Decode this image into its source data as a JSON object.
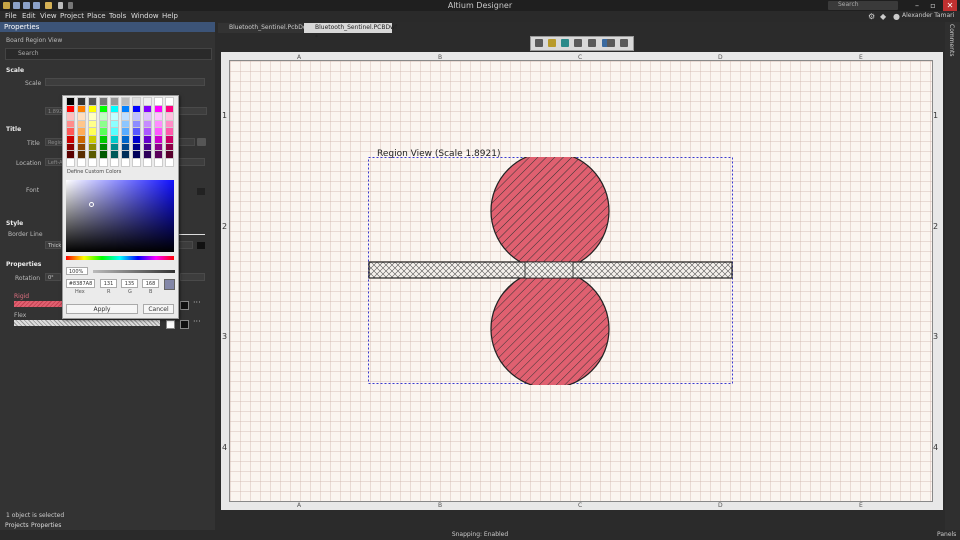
{
  "app": {
    "title": "Altium Designer",
    "search_placeholder": "Search",
    "user": "Alexander Tamari"
  },
  "menu": [
    "File",
    "Edit",
    "View",
    "Project",
    "Place",
    "Tools",
    "Window",
    "Help"
  ],
  "tabs": [
    {
      "label": "Bluetooth_Sentinel.PcbDoc",
      "active": false
    },
    {
      "label": "Bluetooth_Sentinel.PCBDwf *",
      "active": true
    }
  ],
  "panel": {
    "title": "Properties",
    "subtitle": "Board Region View",
    "search_placeholder": "Search",
    "sections": {
      "scale": "Scale",
      "title": "Title",
      "style": "Style",
      "properties": "Properties"
    },
    "labels": {
      "scale": "Scale",
      "title": "Title",
      "location": "Location",
      "font": "Font",
      "border_line": "Border Line",
      "rotation": "Rotation",
      "rigid": "Rigid",
      "flex": "Flex"
    },
    "values": {
      "scale_value": "1.892",
      "title_value": "Regio",
      "location_value": "Left-A",
      "thickness": "Thick",
      "rotation_value": "0°",
      "use_label": "Us"
    }
  },
  "picker": {
    "define_custom": "Define Custom Colors",
    "alpha": "100%",
    "hex": "#8387A8",
    "r": "131",
    "g": "135",
    "b": "168",
    "hex_label": "Hex",
    "r_label": "R",
    "g_label": "G",
    "b_label": "B",
    "apply": "Apply",
    "cancel": "Cancel",
    "selected_color": "#8387a8"
  },
  "canvas": {
    "region_title": "Region View (Scale 1.8921)",
    "columns": [
      "A",
      "B",
      "C",
      "D",
      "E"
    ],
    "rows": [
      "1",
      "2",
      "3",
      "4"
    ],
    "rigid_color": "#e06070",
    "border_color": "#3a3ad0"
  },
  "rail": {
    "label": "Comments"
  },
  "status": {
    "selection": "1 object is selected",
    "snapping": "Snapping: Enabled",
    "panels": "Panels",
    "bottom_tabs": [
      "Projects",
      "Properties"
    ]
  }
}
